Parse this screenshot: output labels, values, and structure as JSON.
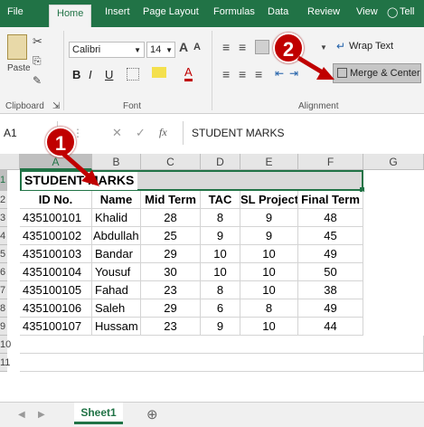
{
  "ribbon_tabs": [
    "File",
    "Home",
    "Insert",
    "Page Layout",
    "Formulas",
    "Data",
    "Review",
    "View",
    "Tell"
  ],
  "tell_icon": "lightbulb-icon",
  "clipboard": {
    "paste": "Paste",
    "group": "Clipboard"
  },
  "font": {
    "name": "Calibri",
    "size": "14",
    "grow": "A",
    "shrink": "A",
    "bold": "B",
    "italic": "I",
    "underline": "U",
    "group": "Font"
  },
  "alignment": {
    "wrap": "Wrap Text",
    "merge": "Merge & Center",
    "group": "Alignment"
  },
  "name_box": "A1",
  "formula_fx": "fx",
  "formula_value": "STUDENT MARKS",
  "columns": [
    "A",
    "B",
    "C",
    "D",
    "E",
    "F",
    "G"
  ],
  "rows": [
    "1",
    "2",
    "3",
    "4",
    "5",
    "6",
    "7",
    "8",
    "9",
    "10",
    "11"
  ],
  "title": "STUDENT MARKS",
  "headers": [
    "ID No.",
    "Name",
    "Mid Term",
    "TAC",
    "SL Project",
    "Final Term"
  ],
  "records": [
    [
      "435100101",
      "Khalid",
      "28",
      "8",
      "9",
      "48"
    ],
    [
      "435100102",
      "Abdullah",
      "25",
      "9",
      "9",
      "45"
    ],
    [
      "435100103",
      "Bandar",
      "29",
      "10",
      "10",
      "49"
    ],
    [
      "435100104",
      "Yousuf",
      "30",
      "10",
      "10",
      "50"
    ],
    [
      "435100105",
      "Fahad",
      "23",
      "8",
      "10",
      "38"
    ],
    [
      "435100106",
      "Saleh",
      "29",
      "6",
      "8",
      "49"
    ],
    [
      "435100107",
      "Hussam",
      "23",
      "9",
      "10",
      "44"
    ]
  ],
  "sheet_tab": "Sheet1",
  "add_sheet": "⊕",
  "callouts": [
    "1",
    "2"
  ],
  "colors": {
    "excel_green": "#217346",
    "callout_red": "#c00000",
    "selection_gray": "#bfbfbf"
  }
}
